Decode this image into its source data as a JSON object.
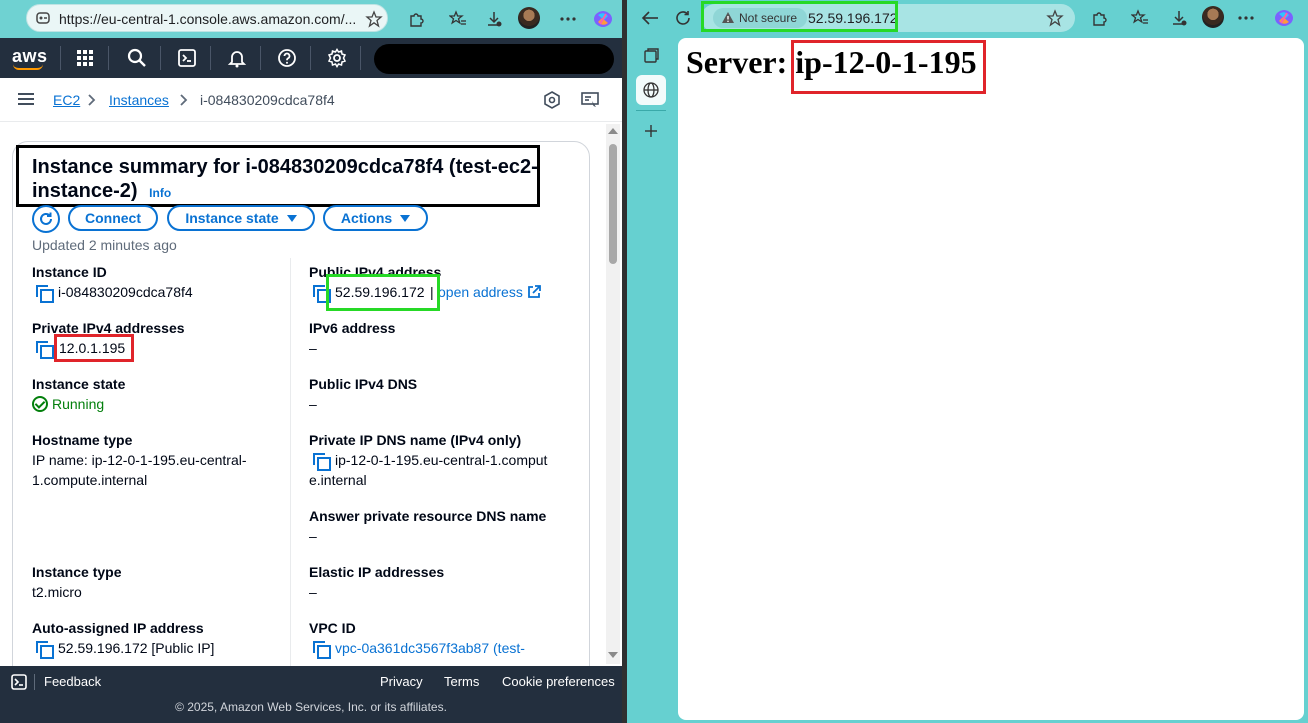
{
  "left_browser": {
    "url": "https://eu-central-1.console.aws.amazon.com/..."
  },
  "aws_nav": {
    "logo": "aws"
  },
  "breadcrumb": {
    "items": [
      "EC2",
      "Instances",
      "i-084830209cdca78f4"
    ]
  },
  "summary": {
    "title": "Instance summary for i-084830209cdca78f4 (test-ec2-instance-2)",
    "info_link": "Info",
    "buttons": {
      "connect": "Connect",
      "instance_state": "Instance state",
      "actions": "Actions"
    },
    "updated": "Updated 2 minutes ago",
    "left_column": [
      {
        "label": "Instance ID",
        "value": "i-084830209cdca78f4"
      },
      {
        "label": "Private IPv4 addresses",
        "value": "12.0.1.195"
      },
      {
        "label": "Instance state",
        "value": "Running"
      },
      {
        "label": "Hostname type",
        "value_line1": "IP name: ip-12-0-1-195.eu-central-",
        "value_line2": "1.compute.internal"
      },
      {
        "label": "Instance type",
        "value": "t2.micro"
      },
      {
        "label": "Auto-assigned IP address",
        "value": "52.59.196.172 [Public IP]"
      }
    ],
    "right_column": [
      {
        "label": "Public IPv4 address",
        "value": "52.59.196.172",
        "separator": "|",
        "link": "open address"
      },
      {
        "label": "IPv6 address",
        "value": "–"
      },
      {
        "label": "Public IPv4 DNS",
        "value": "–"
      },
      {
        "label": "Private IP DNS name (IPv4 only)",
        "value_line1": "ip-12-0-1-195.eu-central-1.comput",
        "value_line2": "e.internal"
      },
      {
        "label": "Answer private resource DNS name",
        "value": "–"
      },
      {
        "label": "Elastic IP addresses",
        "value": "–"
      },
      {
        "label": "VPC ID",
        "value": "vpc-0a361dc3567f3ab87 (test-"
      }
    ]
  },
  "footer": {
    "feedback": "Feedback",
    "privacy": "Privacy",
    "terms": "Terms",
    "cookie": "Cookie preferences",
    "copyright": "© 2025, Amazon Web Services, Inc. or its affiliates."
  },
  "right_browser": {
    "not_secure": "Not secure",
    "url": "52.59.196.172",
    "page_label": "Server:",
    "page_hostname": "ip-12-0-1-195"
  },
  "colors": {
    "aws_nav": "#232f3e",
    "aws_orange": "#ff9900",
    "link_blue": "#0972d3",
    "running_green": "#037f0c",
    "highlight_red": "#e0242a",
    "highlight_green": "#26d926",
    "browser_chrome": "#66d0d0"
  }
}
